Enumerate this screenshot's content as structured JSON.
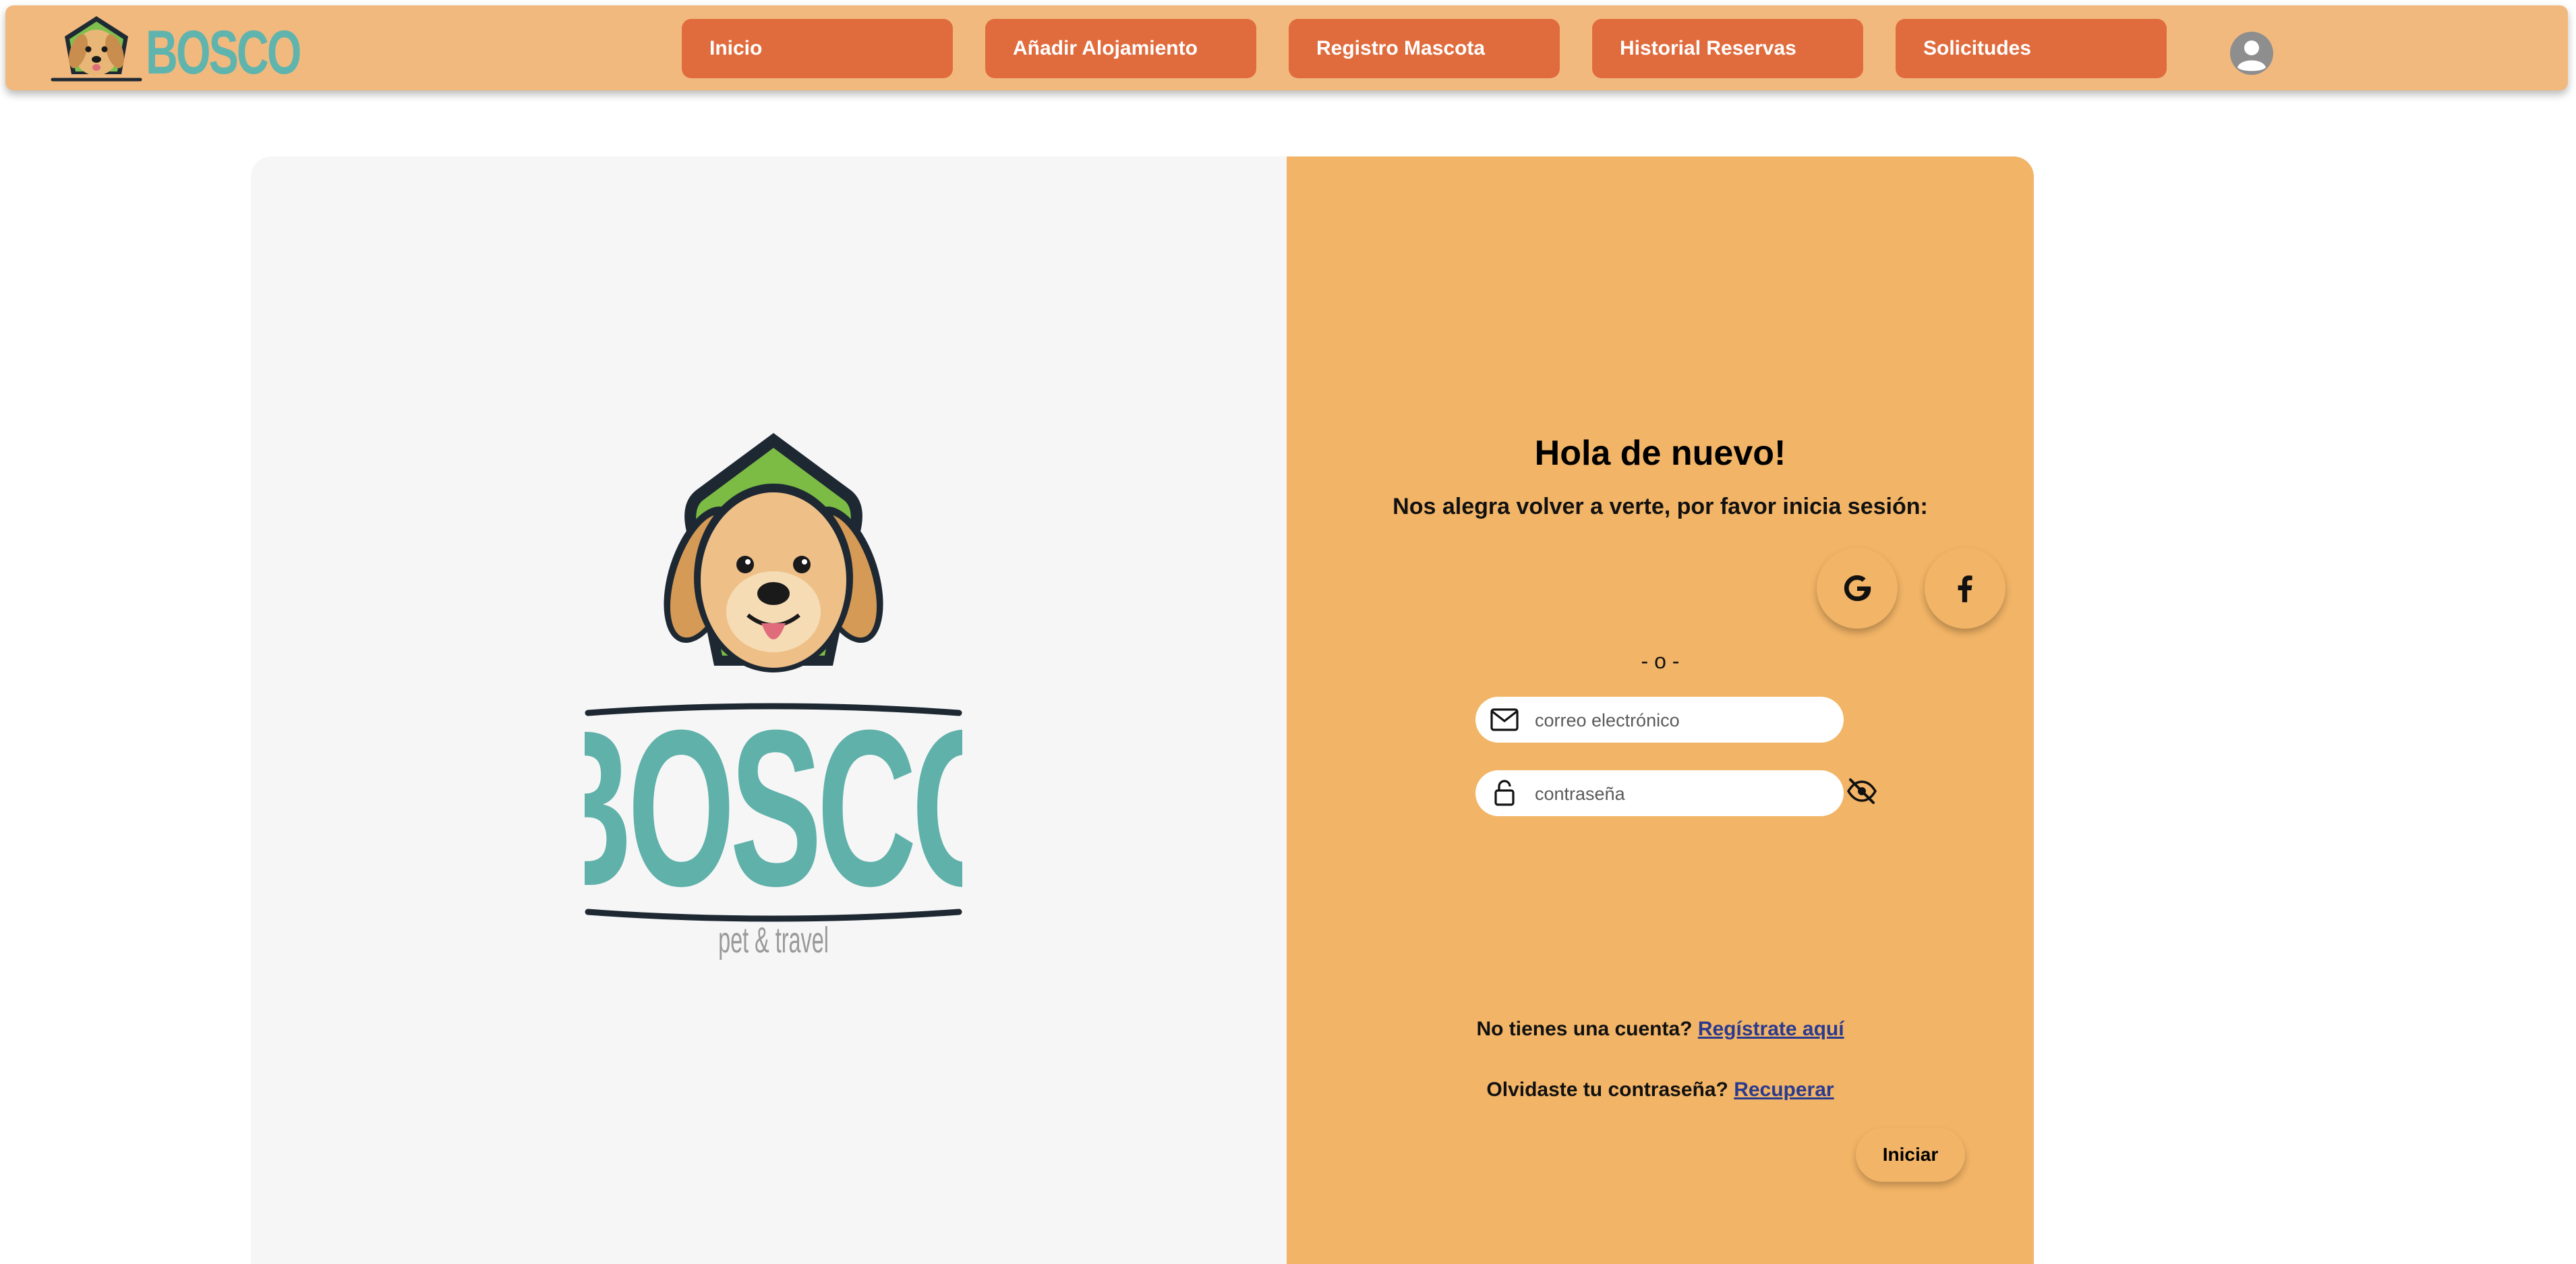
{
  "brand": {
    "name": "BOSCO",
    "tagline": "pet & travel"
  },
  "nav": {
    "items": [
      {
        "label": "Inicio"
      },
      {
        "label": "Añadir Alojamiento"
      },
      {
        "label": "Registro Mascota"
      },
      {
        "label": "Historial Reservas"
      },
      {
        "label": "Solicitudes"
      }
    ]
  },
  "login": {
    "title": "Hola de nuevo!",
    "subtitle": "Nos alegra volver a verte, por favor inicia sesión:",
    "social": [
      "google-icon",
      "facebook-icon"
    ],
    "divider": "- o -",
    "email_placeholder": "correo electrónico",
    "password_placeholder": "contraseña",
    "register_prompt": "No tienes una cuenta?",
    "register_link": "Regístrate aquí",
    "forgot_prompt": "Olvidaste tu contraseña?",
    "forgot_link": "Recuperar",
    "submit_label": "Iniciar"
  },
  "colors": {
    "header_bg": "#f2b97e",
    "nav_button": "#e06c3e",
    "panel_orange": "#f2b466",
    "panel_gray": "#f6f6f6",
    "brand_teal": "#5fb4ad",
    "link_blue": "#2a3a8f"
  }
}
